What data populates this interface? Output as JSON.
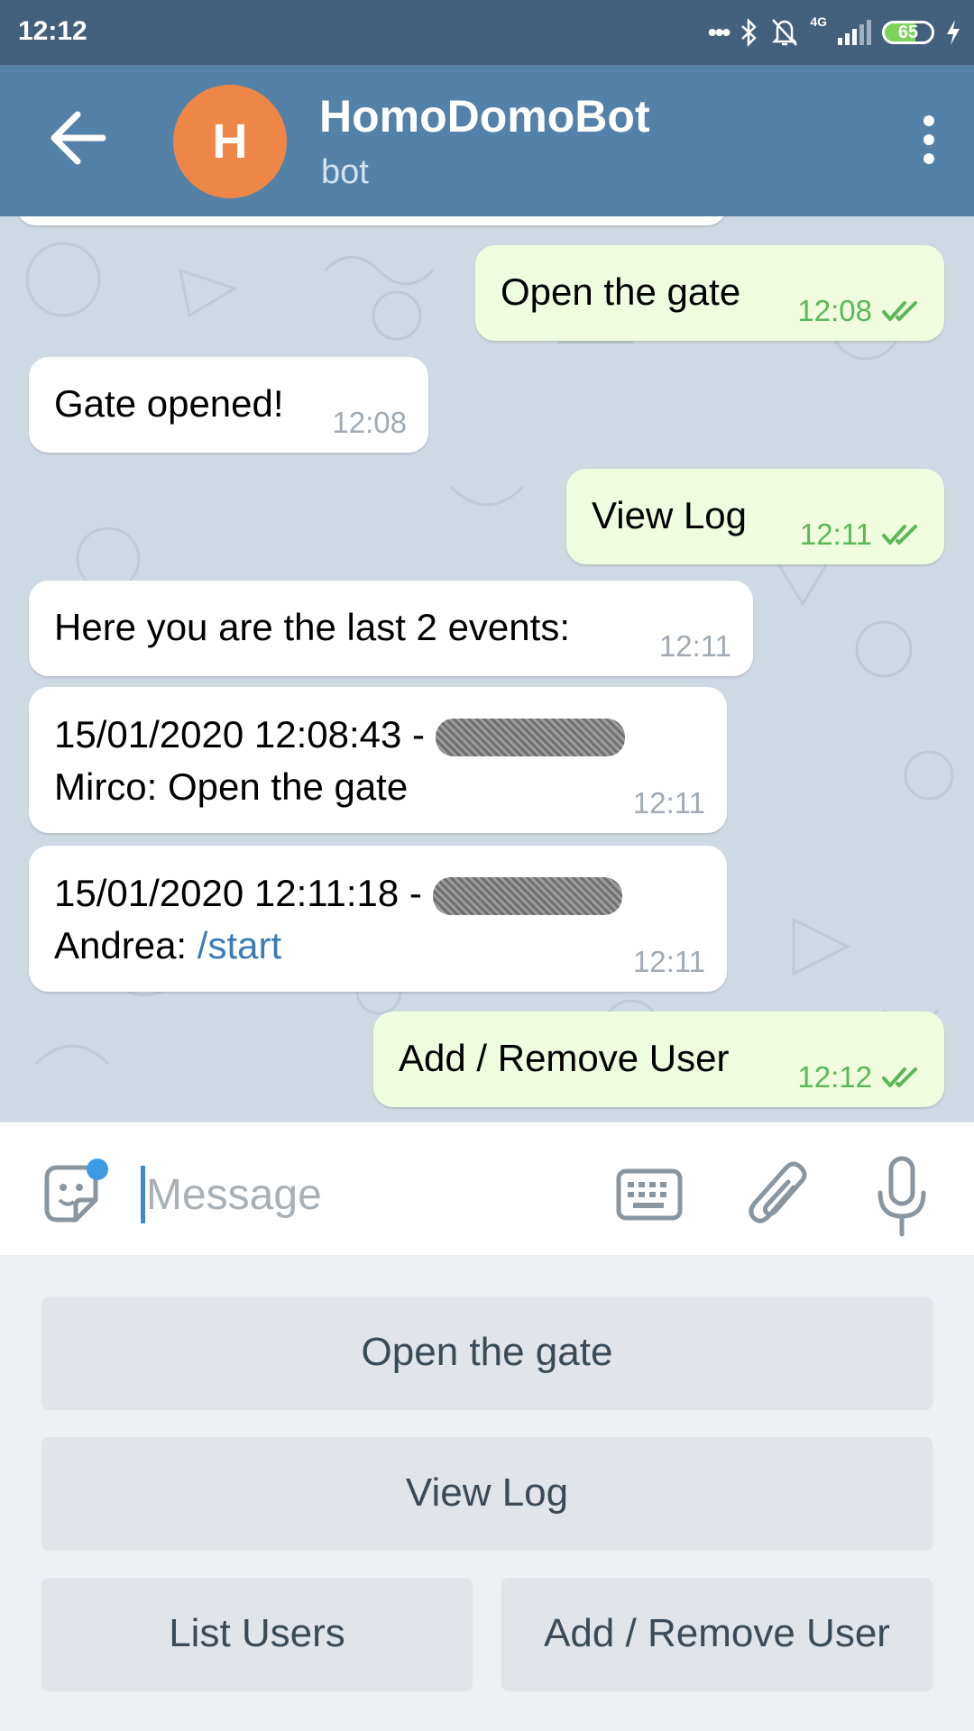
{
  "status_bar": {
    "time": "12:12",
    "network": "4G",
    "battery": "65"
  },
  "header": {
    "avatar_letter": "H",
    "title": "HomoDomoBot",
    "subtitle": "bot",
    "avatar_color": "#ee8647",
    "bar_color": "#5481a7"
  },
  "messages": [
    {
      "dir": "out",
      "text": "Open the gate",
      "time": "12:08"
    },
    {
      "dir": "in",
      "text": "Gate opened!",
      "time": "12:08"
    },
    {
      "dir": "out",
      "text": "View Log",
      "time": "12:11"
    },
    {
      "dir": "in",
      "text": "Here you are the last 2 events:",
      "time": "12:11"
    },
    {
      "dir": "in",
      "line1": "15/01/2020 12:08:43 -",
      "line2": "Mirco: Open the gate",
      "time": "12:11"
    },
    {
      "dir": "in",
      "line1": "15/01/2020 12:11:18 -",
      "line2_prefix": "Andrea: ",
      "line2_cmd": "/start",
      "time": "12:11"
    },
    {
      "dir": "out",
      "text": "Add / Remove User",
      "time": "12:12"
    }
  ],
  "input": {
    "placeholder": "Message"
  },
  "keyboard": {
    "buttons": [
      "Open the gate",
      "View Log",
      "List Users",
      "Add / Remove User"
    ]
  },
  "colors": {
    "outgoing_bubble": "#effdde",
    "incoming_bubble": "#ffffff",
    "read_check": "#5db659",
    "command_link": "#3b7cb5"
  }
}
